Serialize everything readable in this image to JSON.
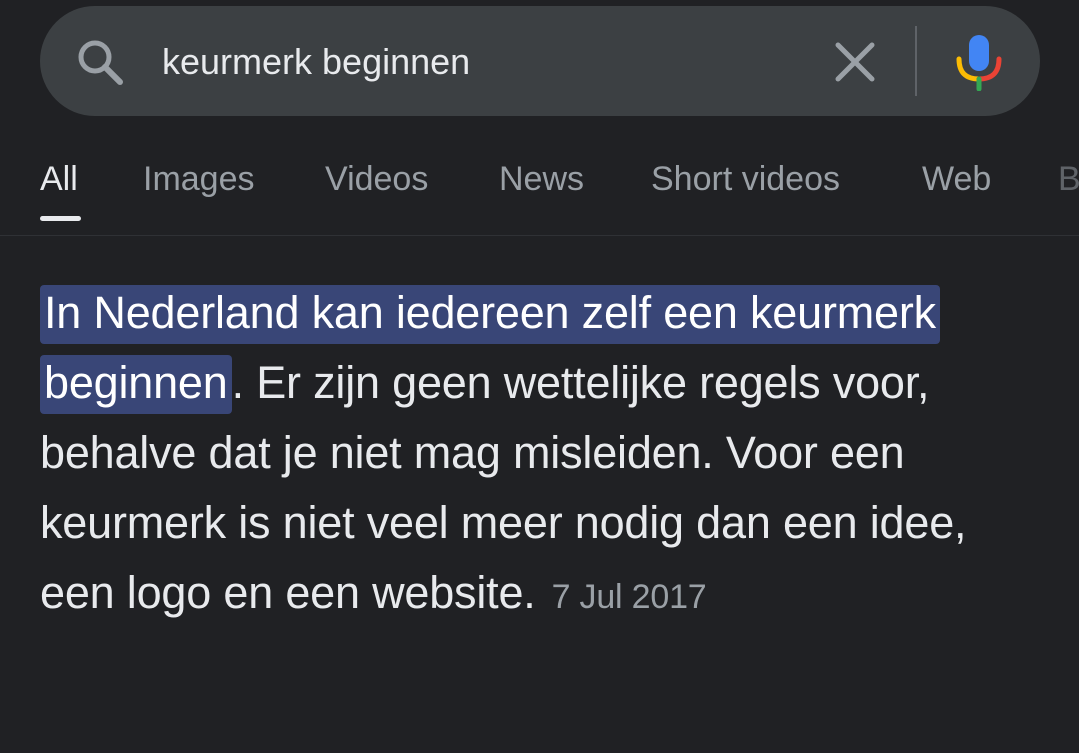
{
  "search": {
    "query": "keurmerk beginnen"
  },
  "icons": {
    "search": "search-icon",
    "clear": "close-icon",
    "mic": "microphone-icon"
  },
  "tabs": [
    {
      "label": "All",
      "active": true
    },
    {
      "label": "Images",
      "active": false
    },
    {
      "label": "Videos",
      "active": false
    },
    {
      "label": "News",
      "active": false
    },
    {
      "label": "Short videos",
      "active": false
    },
    {
      "label": "Web",
      "active": false
    },
    {
      "label": "B",
      "active": false
    }
  ],
  "snippet": {
    "highlight": "In Nederland kan iedereen zelf een keurmerk beginnen",
    "body": ". Er zijn geen wettelijke regels voor, behalve dat je niet mag misleiden. Voor een keurmerk is niet veel meer nodig dan een idee, een logo en een website.",
    "date": "7 Jul 2017"
  },
  "colors": {
    "background": "#202124",
    "search_bar": "#3c4043",
    "highlight": "#394677",
    "text_primary": "#e8eaed",
    "text_secondary": "#9aa0a6",
    "mic_blue": "#4285f4",
    "mic_red": "#ea4335",
    "mic_yellow": "#fbbc04",
    "mic_green": "#34a853"
  }
}
